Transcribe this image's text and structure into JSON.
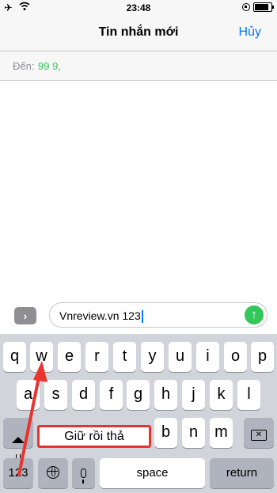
{
  "status_bar": {
    "time": "23:48",
    "battery_level": 0.95
  },
  "nav": {
    "title": "Tin nhắn mới",
    "cancel_label": "Hủy"
  },
  "recipient": {
    "label": "Đến:",
    "value": "99 9,"
  },
  "compose": {
    "text": "Vnreview.vn 123",
    "expand_icon": "chevron-right-icon",
    "send_icon": "arrow-up-icon"
  },
  "keyboard": {
    "row1": [
      "q",
      "w",
      "e",
      "r",
      "t",
      "y",
      "u",
      "i",
      "o",
      "p"
    ],
    "row2": [
      "a",
      "s",
      "d",
      "f",
      "g",
      "h",
      "j",
      "k",
      "l"
    ],
    "row3": [
      "b",
      "n",
      "m"
    ],
    "numbers_label": "123",
    "space_label": "space",
    "return_label": "return"
  },
  "annotation": {
    "text": "Giữ rồi thả",
    "color": "#e8342e"
  }
}
